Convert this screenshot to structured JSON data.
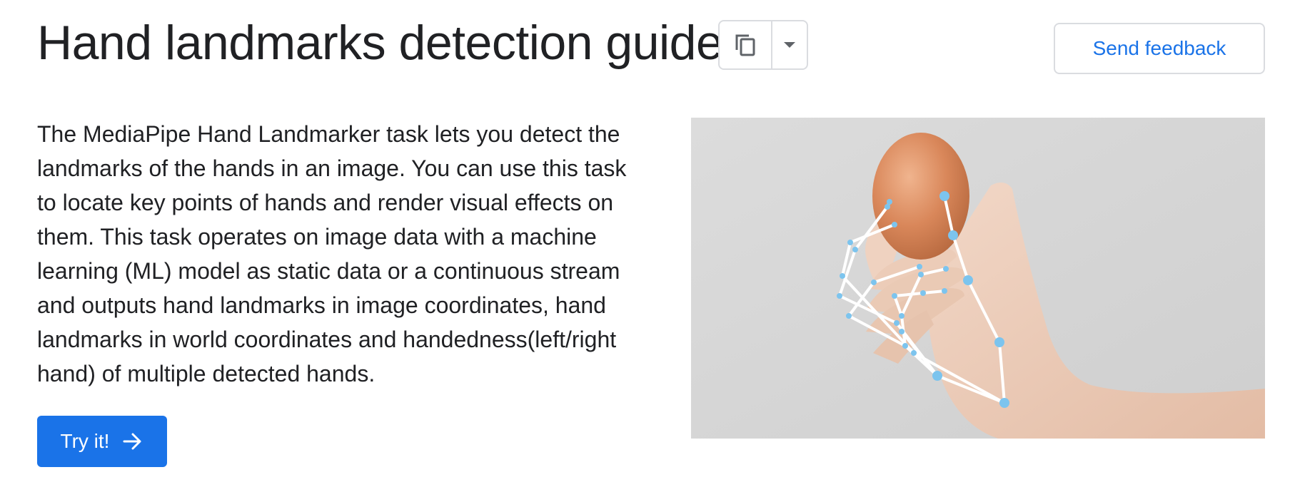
{
  "header": {
    "title": "Hand landmarks detection guide",
    "copy_icon": "copy-icon",
    "dropdown_icon": "caret-down-icon",
    "feedback_label": "Send feedback"
  },
  "main": {
    "description": "The MediaPipe Hand Landmarker task lets you detect the landmarks of the hands in an image. You can use this task to locate key points of hands and render visual effects on them. This task operates on image data with a machine learning (ML) model as static data or a continuous stream and outputs hand landmarks in image coordinates, hand landmarks in world coordinates and handedness(left/right hand) of multiple detected hands.",
    "try_label": "Try it!",
    "try_icon": "arrow-right-icon"
  },
  "illustration": {
    "subject": "hand-holding-egg-with-landmarks",
    "background_color": "#d8d8d8",
    "landmark_color": "#7cc4ee",
    "connection_color": "#ffffff"
  },
  "colors": {
    "accent": "#1a73e8",
    "text": "#202124",
    "border": "#dadce0"
  }
}
